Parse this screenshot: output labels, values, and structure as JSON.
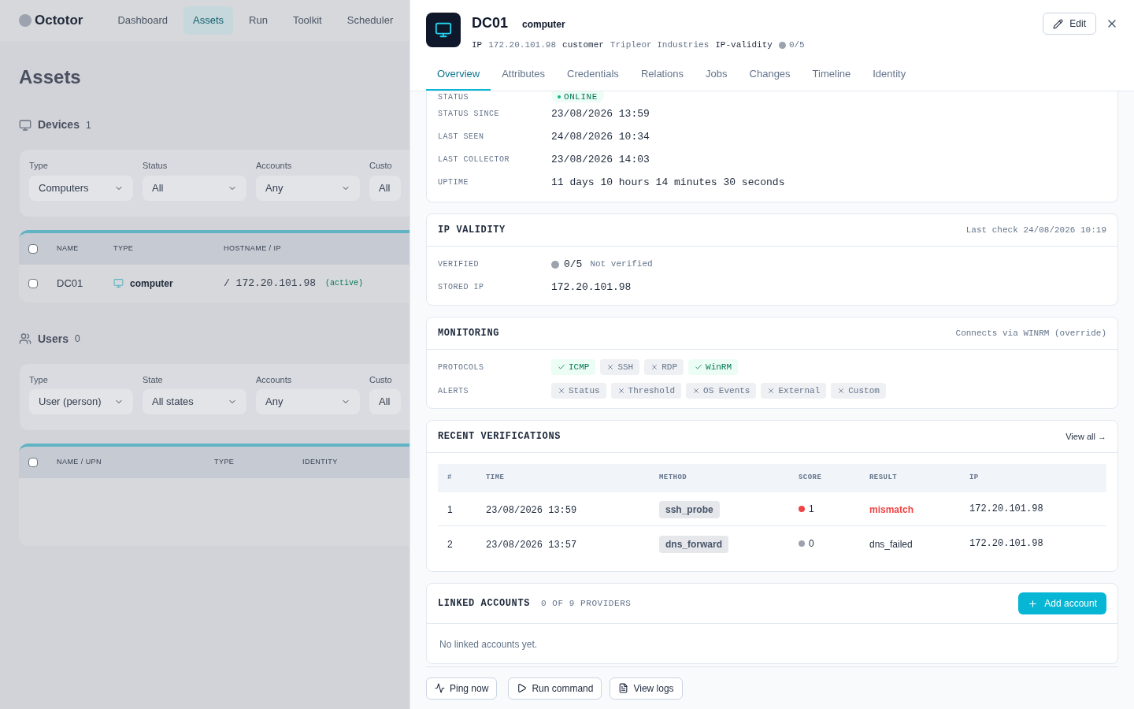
{
  "background": {
    "app_name": "Octotor",
    "nav": [
      {
        "label": "Dashboard",
        "selected": false
      },
      {
        "label": "Assets",
        "selected": true
      },
      {
        "label": "Run",
        "selected": false
      },
      {
        "label": "Toolkit",
        "selected": false
      },
      {
        "label": "Scheduler",
        "selected": false
      }
    ],
    "page_title": "Assets",
    "devices": {
      "title": "Devices",
      "count": "1",
      "filters": [
        {
          "label": "Type",
          "value": "Computers"
        },
        {
          "label": "Status",
          "value": "All"
        },
        {
          "label": "Accounts",
          "value": "Any"
        },
        {
          "label": "Custo",
          "value": "All"
        }
      ],
      "columns": [
        "NAME",
        "TYPE",
        "HOSTNAME / IP"
      ],
      "all_checked": false,
      "rows": [
        {
          "name": "DC01",
          "type": "computer",
          "host": "/ 172.20.101.98",
          "tag": "(active)",
          "checked": false
        }
      ]
    },
    "users": {
      "title": "Users",
      "count": "0",
      "filters": [
        {
          "label": "Type",
          "value": "User (person)"
        },
        {
          "label": "State",
          "value": "All states"
        },
        {
          "label": "Accounts",
          "value": "Any"
        },
        {
          "label": "Custo",
          "value": "All"
        }
      ],
      "columns": [
        "NAME / UPN",
        "TYPE",
        "IDENTITY"
      ],
      "all_checked": false
    }
  },
  "drawer": {
    "title": "DC01",
    "type": "computer",
    "meta": [
      {
        "key": "IP",
        "value": "172.20.101.98"
      },
      {
        "key": "customer",
        "value": "Tripleor Industries"
      }
    ],
    "validity": {
      "label": "IP-validity",
      "value": "0/5",
      "verified": false
    },
    "edit": "Edit",
    "tabs": [
      {
        "label": "Overview",
        "selected": true
      },
      {
        "label": "Attributes",
        "selected": false
      },
      {
        "label": "Credentials",
        "selected": false
      },
      {
        "label": "Relations",
        "selected": false
      },
      {
        "label": "Jobs",
        "selected": false
      },
      {
        "label": "Changes",
        "selected": false
      },
      {
        "label": "Timeline",
        "selected": false
      },
      {
        "label": "Identity",
        "selected": false
      }
    ],
    "status": {
      "label": "STATUS",
      "value": "ONLINE",
      "online": true
    },
    "status_fields": [
      {
        "label": "STATUS SINCE",
        "value": "23/08/2026 13:59"
      },
      {
        "label": "LAST SEEN",
        "value": "24/08/2026 10:34"
      },
      {
        "label": "LAST COLLECTOR",
        "value": "23/08/2026 14:03"
      },
      {
        "label": "UPTIME",
        "value": "11 days 10 hours 14 minutes 30 seconds"
      }
    ],
    "ip_validity": {
      "title": "IP VALIDITY",
      "note": "Last check 24/08/2026 10:19",
      "verified_label": "VERIFIED",
      "verified_value": "0/5",
      "verified_text": "Not verified",
      "verified": false,
      "stored_label": "STORED IP",
      "stored_value": "172.20.101.98"
    },
    "monitoring": {
      "title": "MONITORING",
      "note": "Connects via WINRM (override)",
      "protocols_label": "PROTOCOLS",
      "protocols": [
        {
          "label": "ICMP",
          "on": true
        },
        {
          "label": "SSH",
          "on": false
        },
        {
          "label": "RDP",
          "on": false
        },
        {
          "label": "WinRM",
          "on": true
        }
      ],
      "alerts_label": "ALERTS",
      "alerts": [
        {
          "label": "Status",
          "on": false
        },
        {
          "label": "Threshold",
          "on": false
        },
        {
          "label": "OS Events",
          "on": false
        },
        {
          "label": "External",
          "on": false
        },
        {
          "label": "Custom",
          "on": false
        }
      ]
    },
    "verifications": {
      "title": "RECENT VERIFICATIONS",
      "view_all": "View all →",
      "columns": [
        "#",
        "TIME",
        "METHOD",
        "SCORE",
        "RESULT",
        "IP"
      ],
      "rows": [
        {
          "n": "1",
          "time": "23/08/2026 13:59",
          "method": "ssh_probe",
          "score": "1",
          "color": "#ef4444",
          "result": "mismatch",
          "failed": true,
          "ip": "172.20.101.98"
        },
        {
          "n": "2",
          "time": "23/08/2026 13:57",
          "method": "dns_forward",
          "score": "0",
          "color": "#9ca3af",
          "result": "dns_failed",
          "failed": false,
          "ip": "172.20.101.98"
        }
      ]
    },
    "linked": {
      "title": "LINKED ACCOUNTS",
      "count": "0 OF 9 PROVIDERS",
      "add": "Add account",
      "empty": "No linked accounts yet."
    },
    "actions": [
      {
        "kind": "ping",
        "label": "Ping now"
      },
      {
        "kind": "run",
        "label": "Run command"
      },
      {
        "kind": "logs",
        "label": "View logs"
      }
    ]
  }
}
